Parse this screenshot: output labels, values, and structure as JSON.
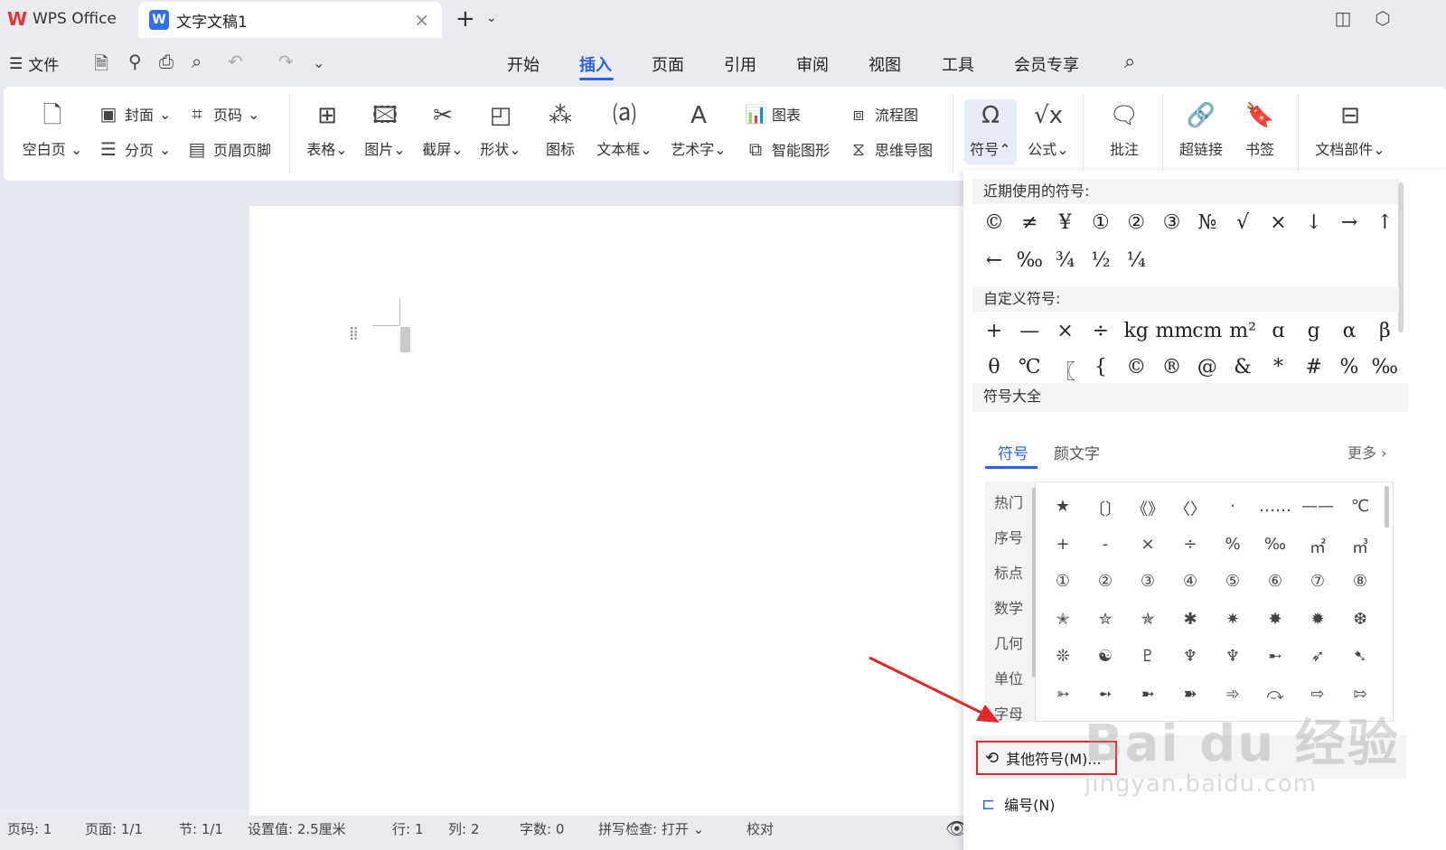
{
  "titlebar": {
    "home_tab": "WPS Office",
    "doc_tab": "文字文稿1"
  },
  "menu": {
    "file": "文件",
    "tabs": [
      "开始",
      "插入",
      "页面",
      "引用",
      "审阅",
      "视图",
      "工具",
      "会员专享"
    ]
  },
  "ribbon": {
    "blank_page": "空白页",
    "cover": "封面",
    "page_number": "页码",
    "page_break": "分页",
    "header_footer": "页眉页脚",
    "table": "表格",
    "picture": "图片",
    "screenshot": "截屏",
    "shape": "形状",
    "icon": "图标",
    "textbox": "文本框",
    "wordart": "艺术字",
    "chart": "图表",
    "smartart": "智能图形",
    "flowchart": "流程图",
    "mindmap": "思维导图",
    "symbol": "符号",
    "formula": "公式",
    "comment": "批注",
    "hyperlink": "超链接",
    "bookmark": "书签",
    "doc_parts": "文档部件"
  },
  "panel": {
    "recent_title": "近期使用的符号:",
    "recent": [
      "©",
      "≠",
      "¥",
      "①",
      "②",
      "③",
      "№",
      "√",
      "×",
      "↓",
      "→",
      "↑",
      "←",
      "‰",
      "¾",
      "½",
      "¼"
    ],
    "custom_title": "自定义符号:",
    "custom": [
      "+",
      "—",
      "×",
      "÷",
      "kg",
      "mm",
      "cm",
      "m²",
      "ɑ",
      "g",
      "α",
      "β",
      "θ",
      "℃",
      "〖",
      "{",
      "©",
      "®",
      "@",
      "&",
      "*",
      "#",
      "%",
      "‰"
    ],
    "all_title": "符号大全",
    "tab_symbols": "符号",
    "tab_emoticons": "颜文字",
    "more": "更多",
    "categories": [
      "热门",
      "序号",
      "标点",
      "数学",
      "几何",
      "单位",
      "字母"
    ],
    "grid": [
      [
        "★",
        "〔〕",
        "《》",
        "〈〉",
        "·",
        "……",
        "——",
        "℃"
      ],
      [
        "+",
        "-",
        "×",
        "÷",
        "%",
        "‰",
        "㎡",
        "㎥"
      ],
      [
        "①",
        "②",
        "③",
        "④",
        "⑤",
        "⑥",
        "⑦",
        "⑧"
      ],
      [
        "✭",
        "✮",
        "✯",
        "✱",
        "✷",
        "✸",
        "✹",
        "❆"
      ],
      [
        "❊",
        "☯",
        "♇",
        "♆",
        "♆",
        "➸",
        "➶",
        "➷"
      ],
      [
        "➳",
        "➻",
        "➼",
        "➽",
        "➾",
        "⤼",
        "⇨",
        "⇰"
      ]
    ],
    "other_symbols": "其他符号(M)...",
    "numbering": "编号(N)"
  },
  "status": {
    "page_code": "页码: 1",
    "page": "页面: 1/1",
    "section": "节: 1/1",
    "setting": "设置值: 2.5厘米",
    "row": "行: 1",
    "col": "列: 2",
    "words": "字数: 0",
    "spell": "拼写检查: 打开",
    "proof": "校对"
  },
  "watermark": {
    "big": "Bai du 经验",
    "small": "jingyan.baidu.com"
  },
  "colors": {
    "accent": "#2a63e8",
    "annotation_red": "#e02a2a"
  }
}
